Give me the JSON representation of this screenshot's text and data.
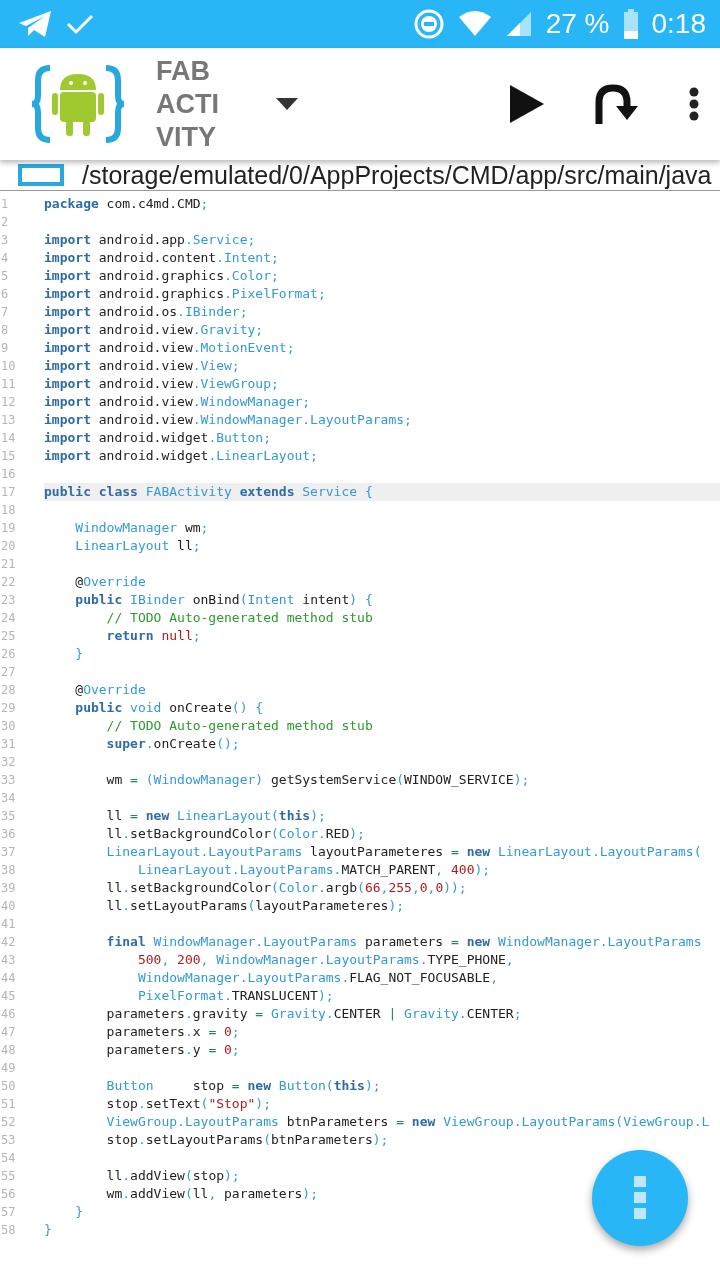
{
  "status_bar": {
    "battery": "27 %",
    "time": "0:18"
  },
  "toolbar": {
    "title": "FAB ACTIVITY"
  },
  "path_bar": {
    "path": "/storage/emulated/0/AppProjects/CMD/app/src/main/java"
  },
  "editor": {
    "lines": [
      {
        "number": "1",
        "current": false,
        "tokens": [
          {
            "kind": "keyword",
            "text": "package"
          },
          {
            "kind": "plain",
            "text": " com.c4md.CMD"
          },
          {
            "kind": "type",
            "text": ";"
          }
        ]
      },
      {
        "number": "2",
        "current": false
      },
      {
        "number": "3",
        "current": false,
        "tokens": [
          {
            "kind": "keyword",
            "text": "import"
          },
          {
            "kind": "plain",
            "text": " android.app"
          },
          {
            "kind": "type",
            "text": ".Service;"
          }
        ]
      },
      {
        "number": "4",
        "current": false,
        "tokens": [
          {
            "kind": "keyword",
            "text": "import"
          },
          {
            "kind": "plain",
            "text": " android.content"
          },
          {
            "kind": "type",
            "text": ".Intent;"
          }
        ]
      },
      {
        "number": "5",
        "current": false,
        "tokens": [
          {
            "kind": "keyword",
            "text": "import"
          },
          {
            "kind": "plain",
            "text": " android.graphics"
          },
          {
            "kind": "type",
            "text": ".Color;"
          }
        ]
      },
      {
        "number": "6",
        "current": false,
        "tokens": [
          {
            "kind": "keyword",
            "text": "import"
          },
          {
            "kind": "plain",
            "text": " android.graphics"
          },
          {
            "kind": "type",
            "text": ".PixelFormat;"
          }
        ]
      },
      {
        "number": "7",
        "current": false,
        "tokens": [
          {
            "kind": "keyword",
            "text": "import"
          },
          {
            "kind": "plain",
            "text": " android.os"
          },
          {
            "kind": "type",
            "text": ".IBinder;"
          }
        ]
      },
      {
        "number": "8",
        "current": false,
        "tokens": [
          {
            "kind": "keyword",
            "text": "import"
          },
          {
            "kind": "plain",
            "text": " android.view"
          },
          {
            "kind": "type",
            "text": ".Gravity;"
          }
        ]
      },
      {
        "number": "9",
        "current": false,
        "tokens": [
          {
            "kind": "keyword",
            "text": "import"
          },
          {
            "kind": "plain",
            "text": " android.view"
          },
          {
            "kind": "type",
            "text": ".MotionEvent;"
          }
        ]
      },
      {
        "number": "10",
        "current": false,
        "tokens": [
          {
            "kind": "keyword",
            "text": "import"
          },
          {
            "kind": "plain",
            "text": " android.view"
          },
          {
            "kind": "type",
            "text": ".View;"
          }
        ]
      },
      {
        "number": "11",
        "current": false,
        "tokens": [
          {
            "kind": "keyword",
            "text": "import"
          },
          {
            "kind": "plain",
            "text": " android.view"
          },
          {
            "kind": "type",
            "text": ".ViewGroup;"
          }
        ]
      },
      {
        "number": "12",
        "current": false,
        "tokens": [
          {
            "kind": "keyword",
            "text": "import"
          },
          {
            "kind": "plain",
            "text": " android.view"
          },
          {
            "kind": "type",
            "text": ".WindowManager;"
          }
        ]
      },
      {
        "number": "13",
        "current": false,
        "tokens": [
          {
            "kind": "keyword",
            "text": "import"
          },
          {
            "kind": "plain",
            "text": " android.view"
          },
          {
            "kind": "type",
            "text": ".WindowManager.LayoutParams;"
          }
        ]
      },
      {
        "number": "14",
        "current": false,
        "tokens": [
          {
            "kind": "keyword",
            "text": "import"
          },
          {
            "kind": "plain",
            "text": " android.widget"
          },
          {
            "kind": "type",
            "text": ".Button;"
          }
        ]
      },
      {
        "number": "15",
        "current": false,
        "tokens": [
          {
            "kind": "keyword",
            "text": "import"
          },
          {
            "kind": "plain",
            "text": " android.widget"
          },
          {
            "kind": "type",
            "text": ".LinearLayout;"
          }
        ]
      },
      {
        "number": "16",
        "current": false
      },
      {
        "number": "17",
        "current": true,
        "tokens": [
          {
            "kind": "keyword",
            "text": "public class "
          },
          {
            "kind": "type",
            "text": "FABActivity "
          },
          {
            "kind": "keyword",
            "text": "extends "
          },
          {
            "kind": "type",
            "text": "Service {"
          }
        ]
      },
      {
        "number": "18",
        "current": false
      },
      {
        "number": "19",
        "current": false,
        "tokens": [
          {
            "kind": "type",
            "text": "    WindowManager"
          },
          {
            "kind": "plain",
            "text": " wm"
          },
          {
            "kind": "type",
            "text": ";"
          }
        ]
      },
      {
        "number": "20",
        "current": false,
        "tokens": [
          {
            "kind": "type",
            "text": "    LinearLayout"
          },
          {
            "kind": "plain",
            "text": " ll"
          },
          {
            "kind": "type",
            "text": ";"
          }
        ]
      },
      {
        "number": "21",
        "current": false
      },
      {
        "number": "22",
        "current": false,
        "tokens": [
          {
            "kind": "plain",
            "text": "    @"
          },
          {
            "kind": "type",
            "text": "Override"
          }
        ]
      },
      {
        "number": "23",
        "current": false,
        "tokens": [
          {
            "kind": "keyword",
            "text": "    public "
          },
          {
            "kind": "type",
            "text": "IBinder "
          },
          {
            "kind": "plain",
            "text": "onBind"
          },
          {
            "kind": "type",
            "text": "(Intent "
          },
          {
            "kind": "plain",
            "text": "intent"
          },
          {
            "kind": "type",
            "text": ") {"
          }
        ]
      },
      {
        "number": "24",
        "current": false,
        "tokens": [
          {
            "kind": "comment",
            "text": "        // TODO Auto-generated method stub"
          }
        ]
      },
      {
        "number": "25",
        "current": false,
        "tokens": [
          {
            "kind": "keyword",
            "text": "        return "
          },
          {
            "kind": "literal",
            "text": "null"
          },
          {
            "kind": "type",
            "text": ";"
          }
        ]
      },
      {
        "number": "26",
        "current": false,
        "tokens": [
          {
            "kind": "type",
            "text": "    }"
          }
        ]
      },
      {
        "number": "27",
        "current": false
      },
      {
        "number": "28",
        "current": false,
        "tokens": [
          {
            "kind": "plain",
            "text": "    @"
          },
          {
            "kind": "type",
            "text": "Override"
          }
        ]
      },
      {
        "number": "29",
        "current": false,
        "tokens": [
          {
            "kind": "keyword",
            "text": "    public "
          },
          {
            "kind": "type",
            "text": "void "
          },
          {
            "kind": "plain",
            "text": "onCreate"
          },
          {
            "kind": "type",
            "text": "() {"
          }
        ]
      },
      {
        "number": "30",
        "current": false,
        "tokens": [
          {
            "kind": "comment",
            "text": "        // TODO Auto-generated method stub"
          }
        ]
      },
      {
        "number": "31",
        "current": false,
        "tokens": [
          {
            "kind": "keyword",
            "text": "        super"
          },
          {
            "kind": "type",
            "text": "."
          },
          {
            "kind": "plain",
            "text": "onCreate"
          },
          {
            "kind": "type",
            "text": "();"
          }
        ]
      },
      {
        "number": "32",
        "current": false
      },
      {
        "number": "33",
        "current": false,
        "tokens": [
          {
            "kind": "plain",
            "text": "        wm "
          },
          {
            "kind": "operator",
            "text": "="
          },
          {
            "kind": "type",
            "text": " (WindowManager) "
          },
          {
            "kind": "plain",
            "text": "getSystemService"
          },
          {
            "kind": "type",
            "text": "("
          },
          {
            "kind": "plain",
            "text": "WINDOW_SERVICE"
          },
          {
            "kind": "type",
            "text": ");"
          }
        ]
      },
      {
        "number": "34",
        "current": false
      },
      {
        "number": "35",
        "current": false,
        "tokens": [
          {
            "kind": "plain",
            "text": "        ll "
          },
          {
            "kind": "operator",
            "text": "="
          },
          {
            "kind": "keyword",
            "text": " new "
          },
          {
            "kind": "type",
            "text": "LinearLayout("
          },
          {
            "kind": "keyword",
            "text": "this"
          },
          {
            "kind": "type",
            "text": ");"
          }
        ]
      },
      {
        "number": "36",
        "current": false,
        "tokens": [
          {
            "kind": "plain",
            "text": "        ll"
          },
          {
            "kind": "type",
            "text": "."
          },
          {
            "kind": "plain",
            "text": "setBackgroundColor"
          },
          {
            "kind": "type",
            "text": "(Color."
          },
          {
            "kind": "plain",
            "text": "RED"
          },
          {
            "kind": "type",
            "text": ");"
          }
        ]
      },
      {
        "number": "37",
        "current": false,
        "tokens": [
          {
            "kind": "type",
            "text": "        LinearLayout.LayoutParams "
          },
          {
            "kind": "plain",
            "text": "layoutParameteres "
          },
          {
            "kind": "operator",
            "text": "="
          },
          {
            "kind": "keyword",
            "text": " new "
          },
          {
            "kind": "type",
            "text": "LinearLayout.LayoutParams("
          }
        ]
      },
      {
        "number": "38",
        "current": false,
        "tokens": [
          {
            "kind": "type",
            "text": "            LinearLayout.LayoutParams."
          },
          {
            "kind": "plain",
            "text": "MATCH_PARENT"
          },
          {
            "kind": "type",
            "text": ", "
          },
          {
            "kind": "literal",
            "text": "400"
          },
          {
            "kind": "type",
            "text": ");"
          }
        ]
      },
      {
        "number": "39",
        "current": false,
        "tokens": [
          {
            "kind": "plain",
            "text": "        ll"
          },
          {
            "kind": "type",
            "text": "."
          },
          {
            "kind": "plain",
            "text": "setBackgroundColor"
          },
          {
            "kind": "type",
            "text": "(Color."
          },
          {
            "kind": "plain",
            "text": "argb"
          },
          {
            "kind": "type",
            "text": "("
          },
          {
            "kind": "literal",
            "text": "66"
          },
          {
            "kind": "type",
            "text": ","
          },
          {
            "kind": "literal",
            "text": "255"
          },
          {
            "kind": "type",
            "text": ","
          },
          {
            "kind": "literal",
            "text": "0"
          },
          {
            "kind": "type",
            "text": ","
          },
          {
            "kind": "literal",
            "text": "0"
          },
          {
            "kind": "type",
            "text": "));"
          }
        ]
      },
      {
        "number": "40",
        "current": false,
        "tokens": [
          {
            "kind": "plain",
            "text": "        ll"
          },
          {
            "kind": "type",
            "text": "."
          },
          {
            "kind": "plain",
            "text": "setLayoutParams"
          },
          {
            "kind": "type",
            "text": "("
          },
          {
            "kind": "plain",
            "text": "layoutParameteres"
          },
          {
            "kind": "type",
            "text": ");"
          }
        ]
      },
      {
        "number": "41",
        "current": false
      },
      {
        "number": "42",
        "current": false,
        "tokens": [
          {
            "kind": "keyword",
            "text": "        final "
          },
          {
            "kind": "type",
            "text": "WindowManager.LayoutParams "
          },
          {
            "kind": "plain",
            "text": "parameters "
          },
          {
            "kind": "operator",
            "text": "="
          },
          {
            "kind": "keyword",
            "text": " new "
          },
          {
            "kind": "type",
            "text": "WindowManager.LayoutParams"
          }
        ]
      },
      {
        "number": "43",
        "current": false,
        "tokens": [
          {
            "kind": "literal",
            "text": "            500"
          },
          {
            "kind": "type",
            "text": ", "
          },
          {
            "kind": "literal",
            "text": "200"
          },
          {
            "kind": "type",
            "text": ", WindowManager.LayoutParams."
          },
          {
            "kind": "plain",
            "text": "TYPE_PHONE"
          },
          {
            "kind": "type",
            "text": ","
          }
        ]
      },
      {
        "number": "44",
        "current": false,
        "tokens": [
          {
            "kind": "type",
            "text": "            WindowManager.LayoutParams."
          },
          {
            "kind": "plain",
            "text": "FLAG_NOT_FOCUSABLE"
          },
          {
            "kind": "type",
            "text": ","
          }
        ]
      },
      {
        "number": "45",
        "current": false,
        "tokens": [
          {
            "kind": "type",
            "text": "            PixelFormat."
          },
          {
            "kind": "plain",
            "text": "TRANSLUCENT"
          },
          {
            "kind": "type",
            "text": ");"
          }
        ]
      },
      {
        "number": "46",
        "current": false,
        "tokens": [
          {
            "kind": "plain",
            "text": "        parameters"
          },
          {
            "kind": "type",
            "text": "."
          },
          {
            "kind": "plain",
            "text": "gravity "
          },
          {
            "kind": "operator",
            "text": "="
          },
          {
            "kind": "type",
            "text": " Gravity."
          },
          {
            "kind": "plain",
            "text": "CENTER "
          },
          {
            "kind": "operator",
            "text": "|"
          },
          {
            "kind": "type",
            "text": " Gravity."
          },
          {
            "kind": "plain",
            "text": "CENTER"
          },
          {
            "kind": "type",
            "text": ";"
          }
        ]
      },
      {
        "number": "47",
        "current": false,
        "tokens": [
          {
            "kind": "plain",
            "text": "        parameters"
          },
          {
            "kind": "type",
            "text": "."
          },
          {
            "kind": "plain",
            "text": "x "
          },
          {
            "kind": "operator",
            "text": "="
          },
          {
            "kind": "literal",
            "text": " 0"
          },
          {
            "kind": "type",
            "text": ";"
          }
        ]
      },
      {
        "number": "48",
        "current": false,
        "tokens": [
          {
            "kind": "plain",
            "text": "        parameters"
          },
          {
            "kind": "type",
            "text": "."
          },
          {
            "kind": "plain",
            "text": "y "
          },
          {
            "kind": "operator",
            "text": "="
          },
          {
            "kind": "literal",
            "text": " 0"
          },
          {
            "kind": "type",
            "text": ";"
          }
        ]
      },
      {
        "number": "49",
        "current": false
      },
      {
        "number": "50",
        "current": false,
        "tokens": [
          {
            "kind": "type",
            "text": "        Button"
          },
          {
            "kind": "plain",
            "text": "     stop "
          },
          {
            "kind": "operator",
            "text": "="
          },
          {
            "kind": "keyword",
            "text": " new "
          },
          {
            "kind": "type",
            "text": "Button("
          },
          {
            "kind": "keyword",
            "text": "this"
          },
          {
            "kind": "type",
            "text": ");"
          }
        ]
      },
      {
        "number": "51",
        "current": false,
        "tokens": [
          {
            "kind": "plain",
            "text": "        stop"
          },
          {
            "kind": "type",
            "text": "."
          },
          {
            "kind": "plain",
            "text": "setText"
          },
          {
            "kind": "type",
            "text": "("
          },
          {
            "kind": "literal",
            "text": "\"Stop\""
          },
          {
            "kind": "type",
            "text": ");"
          }
        ]
      },
      {
        "number": "52",
        "current": false,
        "tokens": [
          {
            "kind": "type",
            "text": "        ViewGroup.LayoutParams "
          },
          {
            "kind": "plain",
            "text": "btnParameters "
          },
          {
            "kind": "operator",
            "text": "="
          },
          {
            "kind": "keyword",
            "text": " new "
          },
          {
            "kind": "type",
            "text": "ViewGroup.LayoutParams(ViewGroup.L"
          }
        ]
      },
      {
        "number": "53",
        "current": false,
        "tokens": [
          {
            "kind": "plain",
            "text": "        stop"
          },
          {
            "kind": "type",
            "text": "."
          },
          {
            "kind": "plain",
            "text": "setLayoutParams"
          },
          {
            "kind": "type",
            "text": "("
          },
          {
            "kind": "plain",
            "text": "btnParameters"
          },
          {
            "kind": "type",
            "text": ");"
          }
        ]
      },
      {
        "number": "54",
        "current": false
      },
      {
        "number": "55",
        "current": false,
        "tokens": [
          {
            "kind": "plain",
            "text": "        ll"
          },
          {
            "kind": "type",
            "text": "."
          },
          {
            "kind": "plain",
            "text": "addView"
          },
          {
            "kind": "type",
            "text": "("
          },
          {
            "kind": "plain",
            "text": "stop"
          },
          {
            "kind": "type",
            "text": ");"
          }
        ]
      },
      {
        "number": "56",
        "current": false,
        "tokens": [
          {
            "kind": "plain",
            "text": "        wm"
          },
          {
            "kind": "type",
            "text": "."
          },
          {
            "kind": "plain",
            "text": "addView"
          },
          {
            "kind": "type",
            "text": "("
          },
          {
            "kind": "plain",
            "text": "ll"
          },
          {
            "kind": "type",
            "text": ", "
          },
          {
            "kind": "plain",
            "text": "parameters"
          },
          {
            "kind": "type",
            "text": ");"
          }
        ]
      },
      {
        "number": "57",
        "current": false,
        "tokens": [
          {
            "kind": "type",
            "text": "    }"
          }
        ]
      },
      {
        "number": "58",
        "current": false,
        "tokens": [
          {
            "kind": "type",
            "text": "}"
          }
        ]
      }
    ]
  }
}
